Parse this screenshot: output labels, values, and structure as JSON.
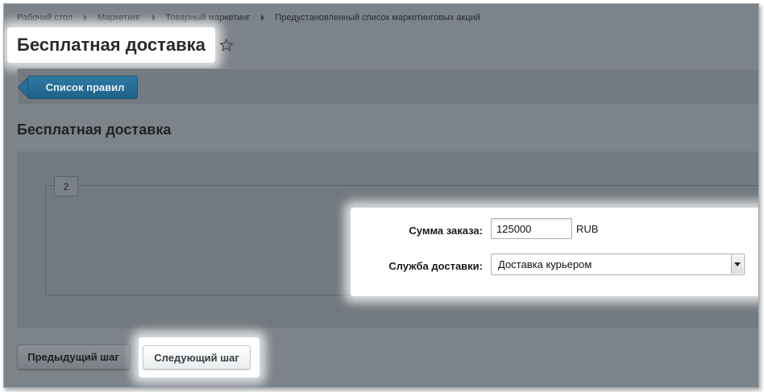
{
  "breadcrumb": {
    "items": [
      "Рабочий стол",
      "Маркетинг",
      "Товарный маркетинг",
      "Предустановленный список маркетинговых акций"
    ]
  },
  "header": {
    "title": "Бесплатная доставка",
    "favorite_icon": "star-icon"
  },
  "toolbar": {
    "list_button_label": "Список правил"
  },
  "form": {
    "section_title": "Бесплатная доставка",
    "step_number": "2",
    "order_sum": {
      "label": "Сумма заказа:",
      "value": "125000",
      "currency": "RUB"
    },
    "delivery_service": {
      "label": "Служба доставки:",
      "selected": "Доставка курьером"
    }
  },
  "footer": {
    "prev_label": "Предыдущий шаг",
    "next_label": "Следующий шаг"
  },
  "colors": {
    "overlay": "#7c8389",
    "primary_button": "#2f7aa3",
    "highlight": "#ffffff"
  }
}
